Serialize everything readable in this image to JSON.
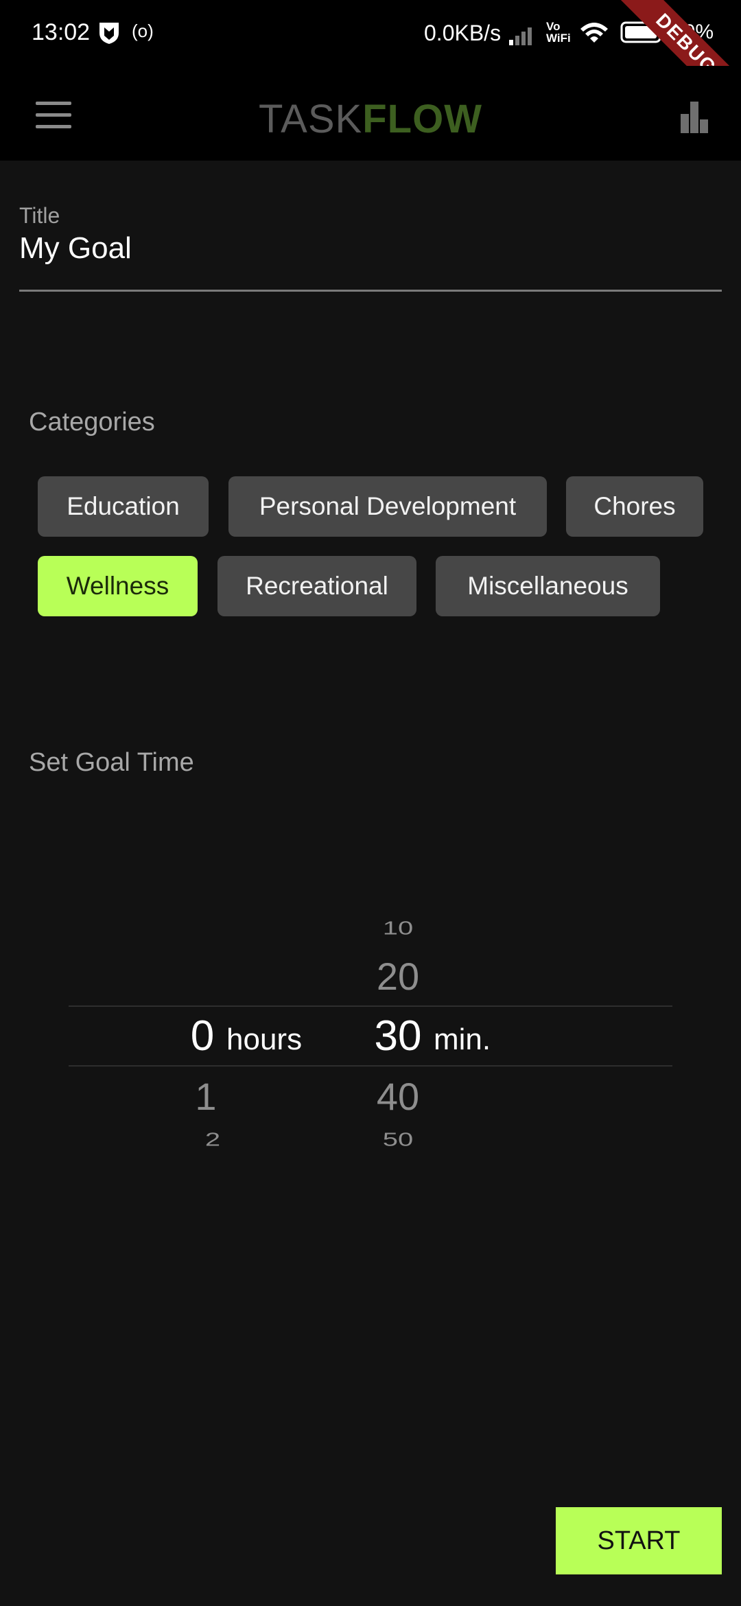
{
  "status_bar": {
    "time": "13:02",
    "network_speed": "0.0KB/s",
    "vowifi_top": "Vo",
    "vowifi_bottom": "WiFi",
    "battery": "90%",
    "icons": [
      "shield-icon",
      "radio-icon",
      "signal-icon",
      "wifi-icon",
      "battery-icon"
    ]
  },
  "debug_banner": "DEBUG",
  "app_bar": {
    "brand_light": "TASK",
    "brand_bold": "FLOW",
    "menu_icon": "hamburger-menu-icon",
    "stats_icon": "bar-chart-icon"
  },
  "title_field": {
    "label": "Title",
    "value": "My Goal"
  },
  "categories": {
    "label": "Categories",
    "items": [
      {
        "label": "Education",
        "selected": false
      },
      {
        "label": "Personal Development",
        "selected": false
      },
      {
        "label": "Chores",
        "selected": false
      },
      {
        "label": "Wellness",
        "selected": true
      },
      {
        "label": "Recreational",
        "selected": false
      },
      {
        "label": "Miscellaneous",
        "selected": false
      }
    ]
  },
  "goal_time": {
    "label": "Set Goal Time",
    "hours": {
      "selected": "0",
      "unit": "hours",
      "below": [
        "1",
        "2"
      ]
    },
    "minutes": {
      "above": [
        "10",
        "20"
      ],
      "selected": "30",
      "unit": "min.",
      "below": [
        "40",
        "50"
      ]
    }
  },
  "start_button": {
    "label": "START"
  },
  "colors": {
    "background": "#121212",
    "accent": "#b8ff57",
    "chip": "#474747",
    "brand_dark": "#5b5b5b",
    "brand_green": "#3d5f20",
    "debug_red": "#8b1a1a"
  }
}
